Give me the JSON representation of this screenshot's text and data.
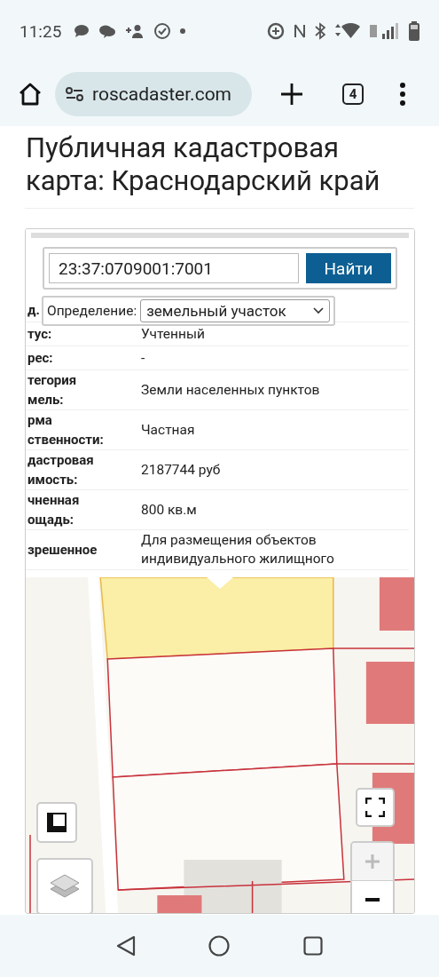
{
  "status_bar": {
    "time": "11:25"
  },
  "browser": {
    "url": "roscadaster.com",
    "tab_count": "4"
  },
  "page_title": "Публичная кадастровая карта: Краснодарский край",
  "search": {
    "value": "23:37:0709001:7001",
    "button": "Найти"
  },
  "definition": {
    "label": "Определение:",
    "value": "земельный участок"
  },
  "properties": [
    {
      "label": "д."
    },
    {
      "label": "тус:",
      "value": "Учтенный"
    },
    {
      "label": "рес:",
      "value": "-"
    },
    {
      "label": "тегория\nмель:",
      "value": "Земли населенных пунктов"
    },
    {
      "label": "рма\nственности:",
      "value": "Частная"
    },
    {
      "label": "дастровая\nимость:",
      "value": "2187744 руб"
    },
    {
      "label": "чненная\nощадь:",
      "value": "800 кв.м"
    },
    {
      "label": "зрешенное",
      "value": "Для размещения объектов\nиндивидуального жилищного"
    }
  ],
  "map_controls": {
    "zoom_in": {
      "disabled": true
    },
    "zoom_out": {
      "disabled": false
    }
  }
}
